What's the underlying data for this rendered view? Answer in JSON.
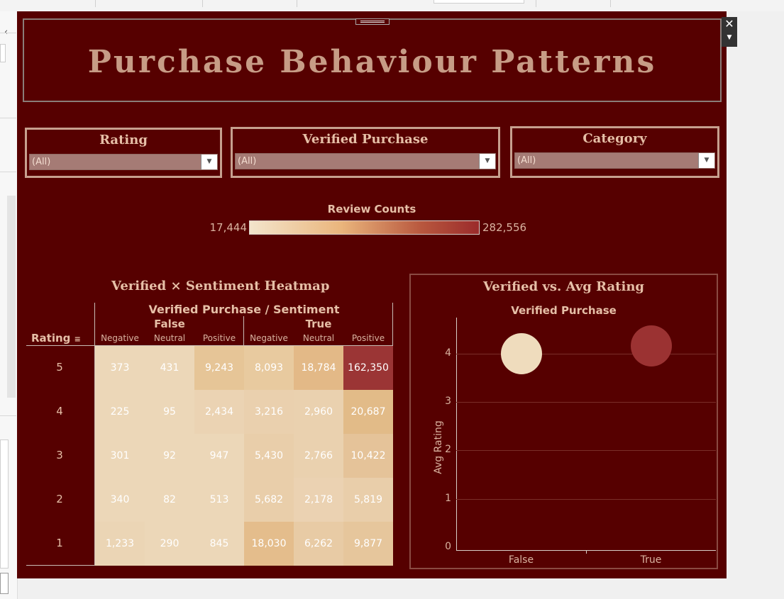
{
  "dashboard": {
    "title": "Purchase Behaviour Patterns",
    "background_color": "#560000",
    "accent_color": "#e6bfa7"
  },
  "filters": [
    {
      "label": "Rating",
      "value": "(All)"
    },
    {
      "label": "Verified Purchase",
      "value": "(All)"
    },
    {
      "label": "Category",
      "value": "(All)"
    }
  ],
  "legend": {
    "title": "Review Counts",
    "min": "17,444",
    "max": "282,556",
    "color_low": "#f3e5cc",
    "color_high": "#9b2b2b"
  },
  "heatmap": {
    "title": "Verified × Sentiment Heatmap",
    "header": "Verified Purchase / Sentiment",
    "row_header": "Rating",
    "groups": [
      "False",
      "True"
    ],
    "columns": [
      "Negative",
      "Neutral",
      "Positive",
      "Negative",
      "Neutral",
      "Positive"
    ],
    "rows": [
      "5",
      "4",
      "3",
      "2",
      "1"
    ],
    "cells": [
      [
        "373",
        "431",
        "9,243",
        "8,093",
        "18,784",
        "162,350"
      ],
      [
        "225",
        "95",
        "2,434",
        "3,216",
        "2,960",
        "20,687"
      ],
      [
        "301",
        "92",
        "947",
        "5,430",
        "2,766",
        "10,422"
      ],
      [
        "340",
        "82",
        "513",
        "5,682",
        "2,178",
        "5,819"
      ],
      [
        "1,233",
        "290",
        "845",
        "18,030",
        "6,262",
        "9,877"
      ]
    ],
    "cell_colors": [
      [
        "#ecd7b8",
        "#ecd7b8",
        "#e6c597",
        "#e8ca9f",
        "#e3b987",
        "#9b3535"
      ],
      [
        "#ecd7b8",
        "#ecd7b8",
        "#ebd3b3",
        "#ead0ae",
        "#ead1af",
        "#e2bb88"
      ],
      [
        "#ecd7b8",
        "#ecd7b8",
        "#ecd7b8",
        "#e9ceaa",
        "#ead1af",
        "#e5c399"
      ],
      [
        "#ecd7b8",
        "#ecd7b8",
        "#ecd7b8",
        "#e9ceaa",
        "#ebd2b2",
        "#e9ceaa"
      ],
      [
        "#ebd5b5",
        "#ecd7b8",
        "#ecd7b8",
        "#e4bd8c",
        "#e8cba5",
        "#e6c69c"
      ]
    ]
  },
  "chart_data": {
    "type": "scatter",
    "title": "Verified vs. Avg Rating",
    "xlabel": "Verified Purchase",
    "ylabel": "Avg Rating",
    "categories": [
      "False",
      "True"
    ],
    "values": [
      4.0,
      4.15
    ],
    "colors": [
      "#efdcbd",
      "#9b3232"
    ],
    "yticks": [
      "0",
      "1",
      "2",
      "3",
      "4"
    ],
    "ylim": [
      0,
      4.8
    ],
    "grid": true
  }
}
